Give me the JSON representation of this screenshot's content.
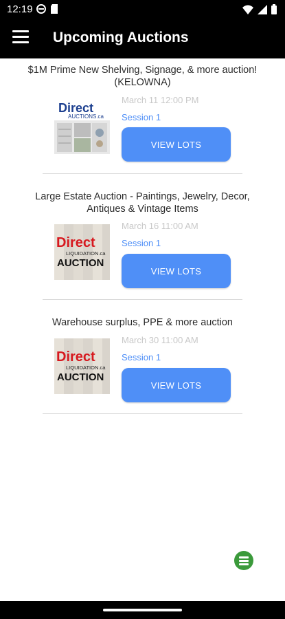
{
  "status_bar": {
    "time": "12:19",
    "icons_left": [
      "vpn-icon",
      "sd-card-icon"
    ],
    "icons_right": [
      "wifi-icon",
      "signal-icon",
      "battery-icon"
    ]
  },
  "app_bar": {
    "title": "Upcoming Auctions",
    "menu_icon": "hamburger-menu-icon"
  },
  "auctions": [
    {
      "title": "$1M Prime New Shelving, Signage, & more auction! (KELOWNA)",
      "date": "March 11 12:00 PM",
      "session": "Session 1",
      "button": "VIEW LOTS",
      "logo_line1": "Direct",
      "logo_line2": "AUCTIONS.ca"
    },
    {
      "title": "Large Estate Auction - Paintings, Jewelry, Decor, Antiques & Vintage Items",
      "date": "March 16 11:00 AM",
      "session": "Session 1",
      "button": "VIEW LOTS",
      "logo_line1": "Direct",
      "logo_line2": "LIQUIDATION.ca",
      "logo_line3": "AUCTION"
    },
    {
      "title": "Warehouse surplus, PPE & more auction",
      "date": "March 30 11:00 AM",
      "session": "Session 1",
      "button": "VIEW LOTS",
      "logo_line1": "Direct",
      "logo_line2": "LIQUIDATION.ca",
      "logo_line3": "AUCTION"
    }
  ],
  "colors": {
    "accent": "#4f8ff7",
    "date_text": "#c8c8c8",
    "app_bar": "#000000",
    "fab": "#3b9a3b"
  },
  "fab_icon": "elementor-icon"
}
